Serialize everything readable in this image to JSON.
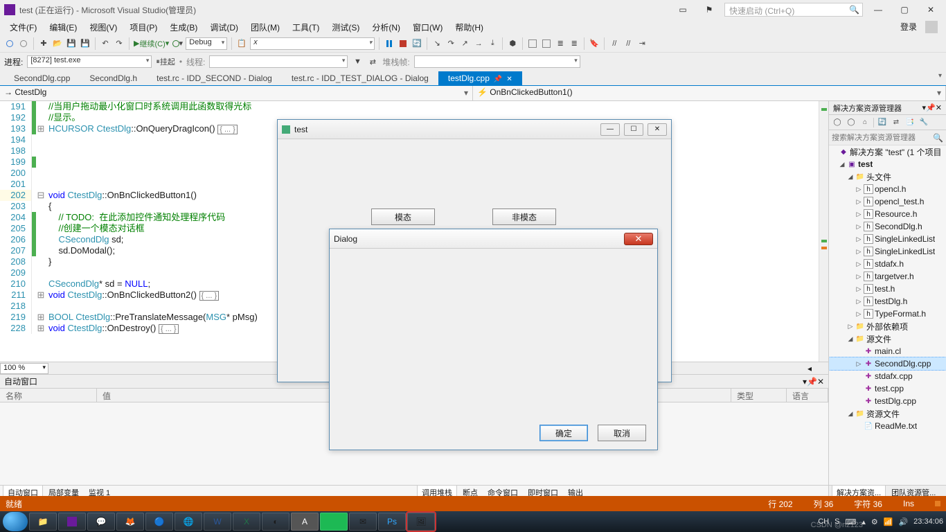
{
  "title": "test (正在运行) - Microsoft Visual Studio(管理员)",
  "quick_launch_placeholder": "快速启动 (Ctrl+Q)",
  "menu": [
    "文件(F)",
    "编辑(E)",
    "视图(V)",
    "项目(P)",
    "生成(B)",
    "调试(D)",
    "团队(M)",
    "工具(T)",
    "测试(S)",
    "分析(N)",
    "窗口(W)",
    "帮助(H)"
  ],
  "login_label": "登录",
  "toolbar": {
    "continue": "继续(C)",
    "config": "Debug",
    "platform_text": "x"
  },
  "toolbar2": {
    "process_label": "进程:",
    "process_value": "[8272] test.exe",
    "suspend": "挂起",
    "thread_label": "线程:",
    "stack_label": "堆栈帧:"
  },
  "doc_tabs": [
    "SecondDlg.cpp",
    "SecondDlg.h",
    "test.rc - IDD_SECOND - Dialog",
    "test.rc - IDD_TEST_DIALOG - Dialog",
    "testDlg.cpp"
  ],
  "nav_scope": "CtestDlg",
  "nav_member": "OnBnClickedButton1()",
  "code": [
    {
      "n": 191,
      "fold": "",
      "mark": "g",
      "txt": "//当用户拖动最小化窗口时系统调用此函数取得光标",
      "cls": "com"
    },
    {
      "n": 192,
      "fold": "",
      "mark": "g",
      "txt": "//显示。",
      "cls": "com"
    },
    {
      "n": 193,
      "fold": "+",
      "mark": "g",
      "raw": "<span class='typ'>HCURSOR</span> <span class='typ'>CtestDlg</span>::OnQueryDragIcon() <span class='collapsed-box'>{ ... }</span>"
    },
    {
      "n": 194,
      "fold": "",
      "mark": "",
      "txt": ""
    },
    {
      "n": 198,
      "fold": "",
      "mark": "",
      "txt": ""
    },
    {
      "n": 199,
      "fold": "",
      "mark": "g",
      "txt": ""
    },
    {
      "n": 200,
      "fold": "",
      "mark": "",
      "txt": ""
    },
    {
      "n": 201,
      "fold": "",
      "mark": "",
      "txt": ""
    },
    {
      "n": 202,
      "fold": "-",
      "mark": "",
      "raw": "<span class='kw'>void</span> <span class='typ'>CtestDlg</span>::OnBnClickedButton1()"
    },
    {
      "n": 203,
      "fold": "",
      "mark": "",
      "txt": "{"
    },
    {
      "n": 204,
      "fold": "",
      "mark": "g",
      "raw": "    <span class='com'>// TODO:  在此添加控件通知处理程序代码</span>"
    },
    {
      "n": 205,
      "fold": "",
      "mark": "g",
      "raw": "    <span class='com'>//创建一个模态对话框</span>"
    },
    {
      "n": 206,
      "fold": "",
      "mark": "g",
      "raw": "    <span class='typ'>CSecondDlg</span> sd;"
    },
    {
      "n": 207,
      "fold": "",
      "mark": "g",
      "raw": "    sd.DoModal();"
    },
    {
      "n": 208,
      "fold": "",
      "mark": "",
      "txt": "}"
    },
    {
      "n": 209,
      "fold": "",
      "mark": "",
      "txt": ""
    },
    {
      "n": 210,
      "fold": "",
      "mark": "",
      "raw": "<span class='typ'>CSecondDlg</span>* sd = <span class='kw'>NULL</span>;"
    },
    {
      "n": 211,
      "fold": "+",
      "mark": "",
      "raw": "<span class='kw'>void</span> <span class='typ'>CtestDlg</span>::OnBnClickedButton2() <span class='collapsed-box'>{ ... }</span>"
    },
    {
      "n": 218,
      "fold": "",
      "mark": "",
      "txt": ""
    },
    {
      "n": 219,
      "fold": "+",
      "mark": "",
      "raw": "<span class='typ'>BOOL</span> <span class='typ'>CtestDlg</span>::PreTranslateMessage(<span class='typ'>MSG</span>* pMsg)"
    },
    {
      "n": 228,
      "fold": "+",
      "mark": "",
      "raw": "<span class='kw'>void</span> <span class='typ'>CtestDlg</span>::OnDestroy() <span class='collapsed-box'>{ ... }</span>"
    }
  ],
  "zoom": "100 %",
  "bottom": {
    "title": "自动窗口",
    "cols": [
      "名称",
      "值",
      "类型",
      "语言"
    ],
    "tabs_left": [
      "自动窗口",
      "局部变量",
      "监视 1"
    ],
    "tabs_right": [
      "调用堆栈",
      "断点",
      "命令窗口",
      "即时窗口",
      "输出"
    ]
  },
  "solution": {
    "title": "解决方案资源管理器",
    "search_placeholder": "搜索解决方案资源管理器",
    "root": "解决方案 \"test\" (1 个项目",
    "project": "test",
    "folders": {
      "headers": "头文件",
      "sources": "源文件",
      "resources": "资源文件",
      "external": "外部依赖项"
    },
    "headers": [
      "opencl.h",
      "opencl_test.h",
      "Resource.h",
      "SecondDlg.h",
      "SingleLinkedList",
      "SingleLinkedList",
      "stdafx.h",
      "targetver.h",
      "test.h",
      "testDlg.h",
      "TypeFormat.h"
    ],
    "sources": [
      "main.cl",
      "SecondDlg.cpp",
      "stdafx.cpp",
      "test.cpp",
      "testDlg.cpp"
    ],
    "resources_items": [
      "ReadMe.txt"
    ],
    "bottom_tabs": [
      "解决方案资...",
      "团队资源管..."
    ]
  },
  "status": {
    "ready": "就绪",
    "line": "行 202",
    "col": "列 36",
    "char": "字符 36",
    "ins": "Ins"
  },
  "app1": {
    "title": "test",
    "btn1": "模态",
    "btn2": "非模态"
  },
  "app2": {
    "title": "Dialog",
    "ok": "确定",
    "cancel": "取消"
  },
  "tray": {
    "ime": "CH",
    "time": "23:34:06",
    "watermark": "CSDN @nz123"
  }
}
